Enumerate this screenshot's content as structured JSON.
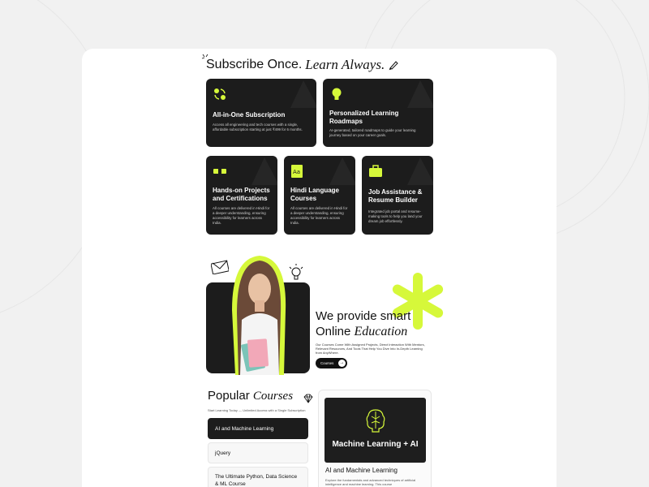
{
  "heading": {
    "text_main": "Subscribe Once.",
    "text_italic": "Learn Always."
  },
  "features": [
    {
      "title": "All-in-One Subscription",
      "desc": "Access all engineering and tech courses with a single, affordable subscription starting at just ₹499 for 6 months.",
      "icon": "people-sync-icon"
    },
    {
      "title": "Personalized Learning Roadmaps",
      "desc": "AI-generated, tailored roadmaps to guide your learning journey based on your career goals.",
      "icon": "lightbulb-icon"
    },
    {
      "title": "Hands-on Projects and Certifications",
      "desc": "All courses are delivered in Hindi for a deeper understanding, ensuring accessibility for learners across India.",
      "icon": "certificate-icon"
    },
    {
      "title": "Hindi Language Courses",
      "desc": "All courses are delivered in Hindi for a deeper understanding, ensuring accessibility for learners across India.",
      "icon": "translate-icon"
    },
    {
      "title": "Job Assistance & Resume Builder",
      "desc": "Integrated job portal and resume-making tools to help you land your dream job effortlessly.",
      "icon": "briefcase-icon"
    }
  ],
  "hero": {
    "title_line1": "We provide smart",
    "title_line2_plain": "Online",
    "title_line2_italic": "Education",
    "desc": "Our Courses Come With Assigned Projects, Direct Interaction With Mentors, Relevant Resources, And Tools That Help You Dive Into In-Depth Learning from AnyWhere.",
    "button_label": "Courses"
  },
  "popular": {
    "title_plain": "Popular",
    "title_italic": "Courses",
    "subtitle": "Start Learning Today — Unlimited Access with a Single Subscription",
    "items": [
      "AI and Machine Learning",
      "jQuery",
      "The Ultimate Python, Data Science & ML Course"
    ],
    "preview": {
      "image_label": "Machine Learning + AI",
      "title": "AI and Machine Learning",
      "desc": "Explore the fundamentals and advanced techniques of artificial intelligence and machine learning. This course"
    }
  },
  "colors": {
    "accent": "#d6f83a",
    "dark": "#1c1c1c",
    "background": "#f1f1f1"
  }
}
